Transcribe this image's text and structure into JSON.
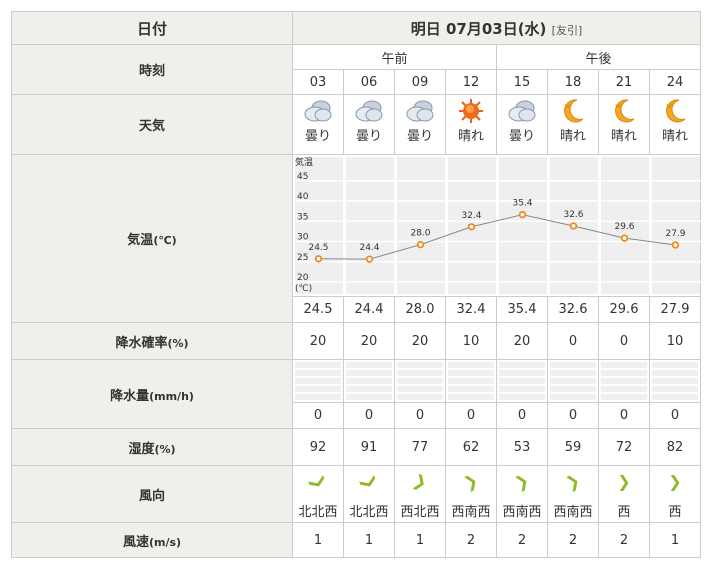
{
  "header": {
    "date_label": "日付",
    "date": "明日 07月03日(水)",
    "rokuyo": "[友引]"
  },
  "labels": {
    "time": "時刻",
    "weather": "天気",
    "temp": "気温",
    "temp_unit": "(℃)",
    "precip_prob": "降水確率",
    "precip_prob_unit": "(%)",
    "precip": "降水量",
    "precip_unit": "(mm/h)",
    "humidity": "湿度",
    "humidity_unit": "(%)",
    "wind_dir": "風向",
    "wind_speed": "風速",
    "wind_speed_unit": "(m/s)"
  },
  "periods": [
    "午前",
    "午後"
  ],
  "hours": [
    "03",
    "06",
    "09",
    "12",
    "15",
    "18",
    "21",
    "24"
  ],
  "weather": [
    {
      "icon": "cloud-icon",
      "text": "曇り"
    },
    {
      "icon": "cloud-icon",
      "text": "曇り"
    },
    {
      "icon": "cloud-icon",
      "text": "曇り"
    },
    {
      "icon": "sun-icon",
      "text": "晴れ"
    },
    {
      "icon": "cloud-icon",
      "text": "曇り"
    },
    {
      "icon": "moon-icon",
      "text": "晴れ"
    },
    {
      "icon": "moon-icon",
      "text": "晴れ"
    },
    {
      "icon": "moon-icon",
      "text": "晴れ"
    }
  ],
  "temps": [
    "24.5",
    "24.4",
    "28.0",
    "32.4",
    "35.4",
    "32.6",
    "29.6",
    "27.9"
  ],
  "precip_prob": [
    "20",
    "20",
    "20",
    "10",
    "20",
    "0",
    "0",
    "10"
  ],
  "precip": [
    "0",
    "0",
    "0",
    "0",
    "0",
    "0",
    "0",
    "0"
  ],
  "humidity": [
    "92",
    "91",
    "77",
    "62",
    "53",
    "59",
    "72",
    "82"
  ],
  "wind_dir": [
    {
      "text": "北北西",
      "deg": 157
    },
    {
      "text": "北北西",
      "deg": 157
    },
    {
      "text": "西北西",
      "deg": 112
    },
    {
      "text": "西南西",
      "deg": 67
    },
    {
      "text": "西南西",
      "deg": 67
    },
    {
      "text": "西南西",
      "deg": 67
    },
    {
      "text": "西",
      "deg": 90
    },
    {
      "text": "西",
      "deg": 90
    }
  ],
  "wind_speed": [
    "1",
    "1",
    "1",
    "2",
    "2",
    "2",
    "2",
    "1"
  ],
  "chart_data": {
    "type": "line",
    "title": "気温",
    "ylabel": "(℃)",
    "categories": [
      "03",
      "06",
      "09",
      "12",
      "15",
      "18",
      "21",
      "24"
    ],
    "values": [
      24.5,
      24.4,
      28.0,
      32.4,
      35.4,
      32.6,
      29.6,
      27.9
    ],
    "yticks": [
      20,
      25,
      30,
      35,
      40,
      45
    ],
    "ylim": [
      17,
      48
    ],
    "line_color": "#888888",
    "marker_color": "#f08a1e"
  }
}
